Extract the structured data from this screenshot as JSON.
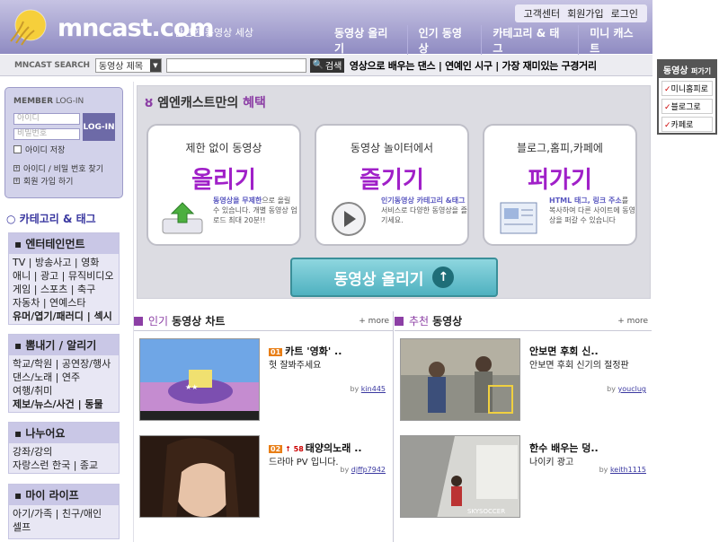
{
  "header": {
    "logo_text": "mncast.com",
    "tagline": "간편한 동영상 세상",
    "top_links": [
      "고객센터",
      "회원가입",
      "로그인"
    ],
    "nav": [
      "동영상 올리기",
      "인기 동영상",
      "카테고리 & 태그",
      "미니 캐스트"
    ]
  },
  "search": {
    "label": "MNCAST SEARCH",
    "select_value": "동영상 제목",
    "button": "검색",
    "hot_words": "영상으로 배우는 댄스 | 연예인 시구 | 가장 재미있는 구경거리"
  },
  "promo": {
    "title": "동영상",
    "title_small": "퍼가기",
    "items": [
      "미니홈피로",
      "블로그로",
      "카페로"
    ]
  },
  "login": {
    "title_bold": "MEMBER",
    "title_rest": " LOG-IN",
    "id_placeholder": "아이디",
    "pw_placeholder": "비밀번호",
    "button": "LOG-IN",
    "save": "아이디 저장",
    "find": "아이디 / 비밀 번호 찾기",
    "join": "회원 가입 하기"
  },
  "categories": {
    "heading": "카테고리 & 태그",
    "groups": [
      {
        "title": "엔터테인먼트",
        "lines": [
          "TV | 방송사고 | 영화",
          "애니 | 광고 | 뮤직비디오",
          "게임 | 스포츠 | 축구",
          "자동차 | 연예스타",
          "유머/엽기/패러디 | 섹시"
        ]
      },
      {
        "title": "뽐내기 / 알리기",
        "lines": [
          "학교/학원 | 공연장/행사",
          "댄스/노래 | 연주",
          "여행/취미",
          "제보/뉴스/사건 | 동물"
        ]
      },
      {
        "title": "나누어요",
        "lines": [
          "강좌/강의",
          "자랑스런 한국 | 종교"
        ]
      },
      {
        "title": "마이 라이프",
        "lines": [
          "아기/가족 | 친구/애인",
          "셀프"
        ]
      }
    ]
  },
  "benefit": {
    "title_pre": "엠엔캐스트만의",
    "title_hl": "혜택",
    "cards": [
      {
        "top": "제한 없이 동영상",
        "big": "올리기",
        "desc_hl": "동영상을 무제한",
        "desc": "으로 올릴 수 있습니다. 개별 동영상 업로드 최대 20분!!"
      },
      {
        "top": "동영상 놀이터에서",
        "big": "즐기기",
        "desc_hl": "인기동영상 카테고리 &태그",
        "desc": " 서비스로 다양한 동영상을 즐기세요."
      },
      {
        "top": "블로그,홈피,카페에",
        "big": "퍼가기",
        "desc_hl": "HTML 태그, 링크 주소",
        "desc": "를 복사하여 다른 사이트에 동영상을 퍼갈 수 있습니다"
      }
    ],
    "upload_button": "동영상 올리기"
  },
  "popular": {
    "head_1": "인기",
    "head_2": "동영상 차트",
    "more": "+ more",
    "items": [
      {
        "rank": "01",
        "change": "",
        "title": "카트 '영화' ..",
        "desc": "헛 잘봐주세요",
        "by": "kin445"
      },
      {
        "rank": "02",
        "change": "↑ 58",
        "title": "태양의노래 ..",
        "desc": "드라마 PV 입니다.",
        "by": "djffp7942"
      }
    ]
  },
  "recommend": {
    "head_1": "추천",
    "head_2": "동영상",
    "more": "+ more",
    "items": [
      {
        "title": "안보면 후회 신..",
        "desc": "안보면 후회 신기의 절정판",
        "by": "youclug"
      },
      {
        "title": "한수 배우는 덩..",
        "desc": "나이키 광고",
        "by": "keith1115"
      }
    ]
  },
  "colors": {
    "brand": "#8f8bc2",
    "accent": "#8c3fa5",
    "button": "#4fb1c0"
  }
}
